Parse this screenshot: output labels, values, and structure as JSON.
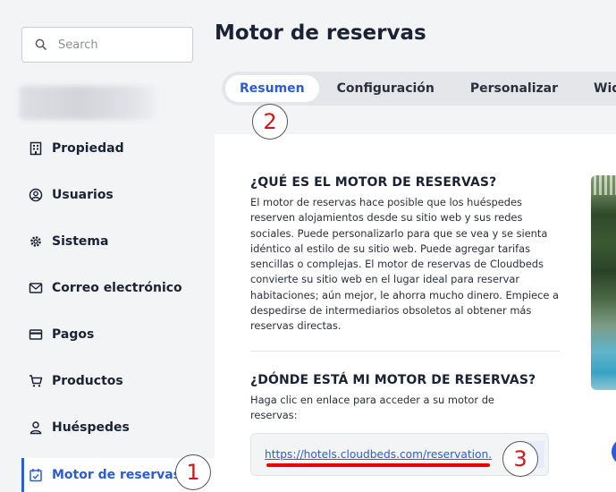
{
  "search": {
    "placeholder": "Search"
  },
  "sidebar": {
    "items": [
      {
        "label": "Propiedad",
        "icon": "building-icon"
      },
      {
        "label": "Usuarios",
        "icon": "user-circle-icon"
      },
      {
        "label": "Sistema",
        "icon": "gear-icon"
      },
      {
        "label": "Correo electrónico",
        "icon": "envelope-icon"
      },
      {
        "label": "Pagos",
        "icon": "credit-card-icon"
      },
      {
        "label": "Productos",
        "icon": "cart-icon"
      },
      {
        "label": "Huéspedes",
        "icon": "person-icon"
      },
      {
        "label": "Motor de reservas",
        "icon": "calendar-check-icon",
        "active": true
      }
    ]
  },
  "header": {
    "title": "Motor de reservas"
  },
  "tabs": [
    {
      "label": "Resumen",
      "active": true
    },
    {
      "label": "Configuración"
    },
    {
      "label": "Personalizar"
    },
    {
      "label": "Widget"
    }
  ],
  "main": {
    "section1": {
      "heading": "¿QUÉ ES EL MOTOR DE RESERVAS?",
      "body": "El motor de reservas hace posible que los huéspedes reserven alojamientos desde su sitio web y sus redes sociales. Puede personalizarlo para que se vea y se sienta idéntico al estilo de su sitio web. Puede agregar tarifas sencillas o complejas. El motor de reservas de Cloudbeds convierte su sitio web en el lugar ideal para reservar habitaciones; aún mejor, le ahorra mucho dinero. Empiece a despedirse de intermediarios obsoletos al obtener más reservas directas."
    },
    "section2": {
      "heading": "¿DÓNDE ESTÁ MI MOTOR DE RESERVAS?",
      "body": "Haga clic en enlace para acceder a su motor de reservas:",
      "url": "https://hotels.cloudbeds.com/reservation."
    }
  },
  "annotations": {
    "step1": "1",
    "step2": "2",
    "step3": "3"
  },
  "colors": {
    "accent": "#2d5bd7",
    "annotation": "#dd1111"
  }
}
